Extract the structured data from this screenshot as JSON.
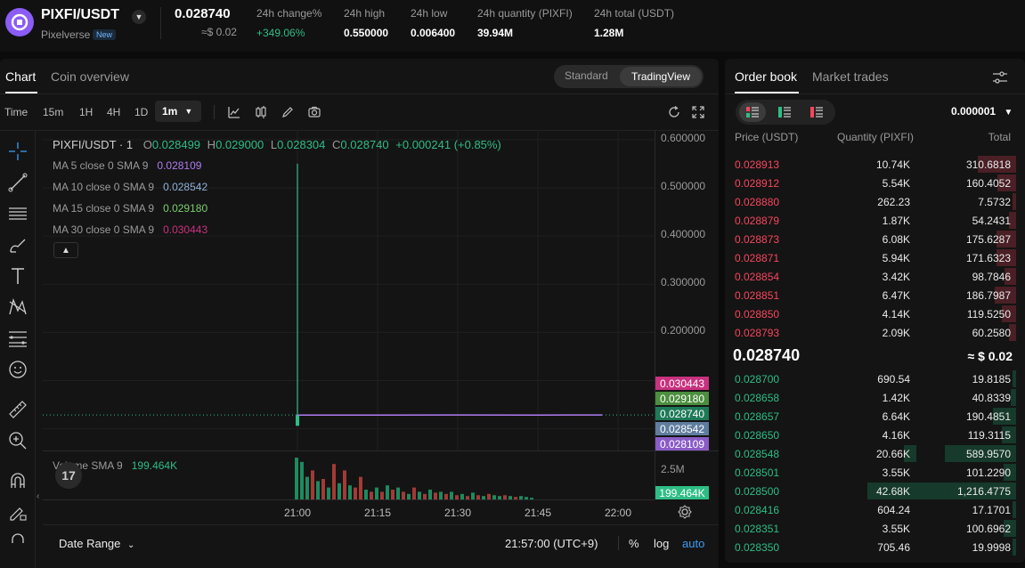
{
  "header": {
    "pair": "PIXFI/USDT",
    "project": "Pixelverse",
    "new_badge": "New",
    "last_price": "0.028740",
    "last_price_usd": "≈$ 0.02",
    "stats": [
      {
        "label": "24h change%",
        "value": "+349.06%"
      },
      {
        "label": "24h high",
        "value": "0.550000"
      },
      {
        "label": "24h low",
        "value": "0.006400"
      },
      {
        "label": "24h quantity (PIXFI)",
        "value": "39.94M"
      },
      {
        "label": "24h total (USDT)",
        "value": "1.28M"
      }
    ]
  },
  "chart_panel": {
    "tabs": [
      "Chart",
      "Coin overview"
    ],
    "view_modes": [
      "Standard",
      "TradingView"
    ],
    "timeframes": [
      "Time",
      "15m",
      "1H",
      "4H",
      "1D"
    ],
    "active_timeframe": "1m",
    "legend": {
      "symbol": "PIXFI/USDT · 1",
      "o_label": "O",
      "o": "0.028499",
      "h_label": "H",
      "h": "0.029000",
      "l_label": "L",
      "l": "0.028304",
      "c_label": "C",
      "c": "0.028740",
      "change": "+0.000241 (+0.85%)",
      "ma": [
        {
          "label": "MA 5 close 0 SMA 9",
          "value": "0.028109",
          "color": "#b07cf0"
        },
        {
          "label": "MA 10 close 0 SMA 9",
          "value": "0.028542",
          "color": "#8fb0d8"
        },
        {
          "label": "MA 15 close 0 SMA 9",
          "value": "0.029180",
          "color": "#7bd06c"
        },
        {
          "label": "MA 30 close 0 SMA 9",
          "value": "0.030443",
          "color": "#c8327f"
        }
      ]
    },
    "volume_legend": {
      "label": "Volume SMA 9",
      "value": "199.464K"
    },
    "tv_badge": "17",
    "bottom": {
      "date_range": "Date Range",
      "clock": "21:57:00 (UTC+9)",
      "pct": "%",
      "log": "log",
      "auto": "auto"
    }
  },
  "chart_data": {
    "type": "line",
    "xlabel": "",
    "ylabel": "",
    "x_ticks": [
      "21:00",
      "21:15",
      "21:30",
      "21:45",
      "22:00"
    ],
    "y_ticks": [
      "0.600000",
      "0.500000",
      "0.400000",
      "0.300000",
      "0.200000"
    ],
    "ylim": [
      0.0,
      0.62
    ],
    "series": [
      {
        "name": "price",
        "x": [
          "21:00",
          "21:15",
          "21:30",
          "21:45",
          "21:57"
        ],
        "values": [
          0.0285,
          0.0285,
          0.0287,
          0.0286,
          0.02874
        ],
        "spike_high": 0.55
      }
    ],
    "price_labels": [
      {
        "value": "0.030443",
        "color": "#c8327f"
      },
      {
        "value": "0.029180",
        "color": "#4c8f3f"
      },
      {
        "value": "0.028740",
        "color": "#1e7a59"
      },
      {
        "value": "0.028542",
        "color": "#5f7d9f"
      },
      {
        "value": "0.028109",
        "color": "#8b5cc7"
      }
    ],
    "volume": {
      "ylabel_tick": "2.5M",
      "current_label": "199.464K",
      "bars": [
        {
          "v": 1.0,
          "up": true
        },
        {
          "v": 0.9,
          "up": true
        },
        {
          "v": 0.55,
          "up": true
        },
        {
          "v": 0.7,
          "up": false
        },
        {
          "v": 0.45,
          "up": true
        },
        {
          "v": 0.5,
          "up": false
        },
        {
          "v": 0.3,
          "up": true
        },
        {
          "v": 0.85,
          "up": false
        },
        {
          "v": 0.4,
          "up": true
        },
        {
          "v": 0.7,
          "up": false
        },
        {
          "v": 0.35,
          "up": true
        },
        {
          "v": 0.3,
          "up": false
        },
        {
          "v": 0.55,
          "up": false
        },
        {
          "v": 0.25,
          "up": true
        },
        {
          "v": 0.2,
          "up": false
        },
        {
          "v": 0.3,
          "up": true
        },
        {
          "v": 0.2,
          "up": false
        },
        {
          "v": 0.35,
          "up": true
        },
        {
          "v": 0.25,
          "up": false
        },
        {
          "v": 0.3,
          "up": true
        },
        {
          "v": 0.2,
          "up": false
        },
        {
          "v": 0.15,
          "up": true
        },
        {
          "v": 0.3,
          "up": false
        },
        {
          "v": 0.2,
          "up": true
        },
        {
          "v": 0.15,
          "up": false
        },
        {
          "v": 0.25,
          "up": true
        },
        {
          "v": 0.18,
          "up": false
        },
        {
          "v": 0.2,
          "up": true
        },
        {
          "v": 0.15,
          "up": false
        },
        {
          "v": 0.2,
          "up": true
        },
        {
          "v": 0.12,
          "up": false
        },
        {
          "v": 0.15,
          "up": true
        },
        {
          "v": 0.1,
          "up": false
        },
        {
          "v": 0.18,
          "up": true
        },
        {
          "v": 0.12,
          "up": false
        },
        {
          "v": 0.1,
          "up": true
        },
        {
          "v": 0.15,
          "up": false
        },
        {
          "v": 0.12,
          "up": true
        },
        {
          "v": 0.1,
          "up": true
        },
        {
          "v": 0.12,
          "up": false
        },
        {
          "v": 0.1,
          "up": true
        },
        {
          "v": 0.08,
          "up": false
        },
        {
          "v": 0.1,
          "up": true
        },
        {
          "v": 0.08,
          "up": true
        },
        {
          "v": 0.06,
          "up": true
        }
      ]
    }
  },
  "order_book": {
    "tabs": [
      "Order book",
      "Market trades"
    ],
    "precision": "0.000001",
    "columns": [
      "Price (USDT)",
      "Quantity (PIXFI)",
      "Total"
    ],
    "asks": [
      {
        "price": "0.028913",
        "qty": "10.74K",
        "total": "310.6818",
        "depth": 0.27
      },
      {
        "price": "0.028912",
        "qty": "5.54K",
        "total": "160.4052",
        "depth": 0.13
      },
      {
        "price": "0.028880",
        "qty": "262.23",
        "total": "7.5732",
        "depth": 0.01
      },
      {
        "price": "0.028879",
        "qty": "1.87K",
        "total": "54.2431",
        "depth": 0.05
      },
      {
        "price": "0.028873",
        "qty": "6.08K",
        "total": "175.6287",
        "depth": 0.14
      },
      {
        "price": "0.028871",
        "qty": "5.94K",
        "total": "171.6323",
        "depth": 0.14
      },
      {
        "price": "0.028854",
        "qty": "3.42K",
        "total": "98.7846",
        "depth": 0.08
      },
      {
        "price": "0.028851",
        "qty": "6.47K",
        "total": "186.7987",
        "depth": 0.15
      },
      {
        "price": "0.028850",
        "qty": "4.14K",
        "total": "119.5250",
        "depth": 0.1
      },
      {
        "price": "0.028793",
        "qty": "2.09K",
        "total": "60.2580",
        "depth": 0.05
      }
    ],
    "mid_price": "0.028740",
    "mid_usd": "≈ $ 0.02",
    "bids": [
      {
        "price": "0.028700",
        "qty": "690.54",
        "total": "19.8185",
        "depth": 0.02,
        "qdepth": 0
      },
      {
        "price": "0.028658",
        "qty": "1.42K",
        "total": "40.8339",
        "depth": 0.04,
        "qdepth": 0
      },
      {
        "price": "0.028657",
        "qty": "6.64K",
        "total": "190.4851",
        "depth": 0.16,
        "qdepth": 0
      },
      {
        "price": "0.028650",
        "qty": "4.16K",
        "total": "119.3115",
        "depth": 0.1,
        "qdepth": 0
      },
      {
        "price": "0.028548",
        "qty": "20.66K",
        "total": "589.9570",
        "depth": 0.5,
        "qdepth": 0.25
      },
      {
        "price": "0.028501",
        "qty": "3.55K",
        "total": "101.2290",
        "depth": 0.09,
        "qdepth": 0
      },
      {
        "price": "0.028500",
        "qty": "42.68K",
        "total": "1,216.4775",
        "depth": 1.0,
        "qdepth": 1.0
      },
      {
        "price": "0.028416",
        "qty": "604.24",
        "total": "17.1701",
        "depth": 0.02,
        "qdepth": 0
      },
      {
        "price": "0.028351",
        "qty": "3.55K",
        "total": "100.6962",
        "depth": 0.09,
        "qdepth": 0
      },
      {
        "price": "0.028350",
        "qty": "705.46",
        "total": "19.9998",
        "depth": 0.02,
        "qdepth": 0
      }
    ]
  }
}
